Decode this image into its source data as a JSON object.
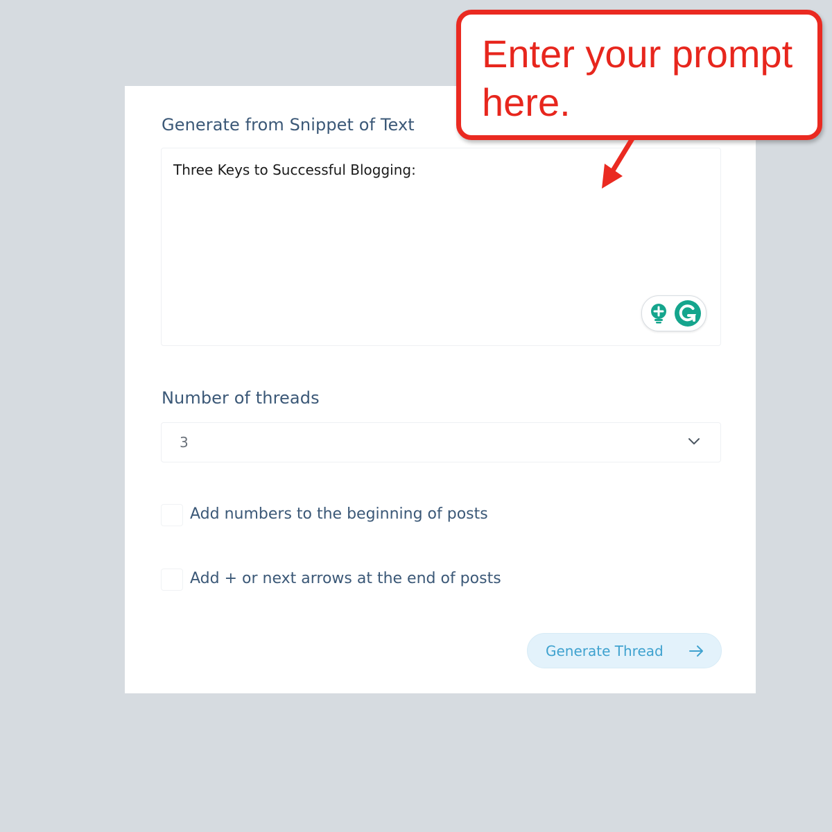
{
  "form": {
    "snippet_label": "Generate from Snippet of Text",
    "snippet_value": "Three Keys to Successful Blogging:",
    "threads_label": "Number of threads",
    "threads_value": "3",
    "checkbox_numbers_label": "Add numbers to the beginning of posts",
    "checkbox_numbers_checked": false,
    "checkbox_arrows_label": "Add + or next arrows at the end of posts",
    "checkbox_arrows_checked": false,
    "generate_button_label": "Generate Thread"
  },
  "grammarly_widget": {
    "icons": [
      "lightbulb-icon",
      "grammarly-g-icon"
    ],
    "accent": "#15a58d"
  },
  "annotation": {
    "text": "Enter your prompt here.",
    "color": "#ea2a21"
  },
  "colors": {
    "background": "#d6dbe0",
    "label": "#3b5877",
    "button_bg": "#e3f2fb",
    "button_text": "#3fa2cf"
  }
}
